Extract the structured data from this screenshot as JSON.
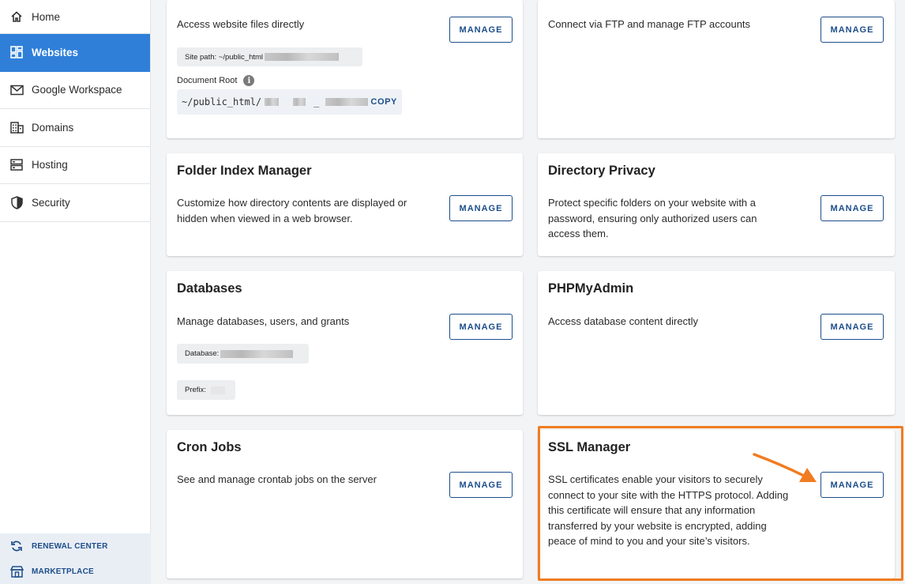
{
  "sidebar": {
    "items": [
      {
        "label": "Home",
        "icon": "home-icon"
      },
      {
        "label": "Websites",
        "icon": "websites-grid-icon"
      },
      {
        "label": "Google Workspace",
        "icon": "mail-icon"
      },
      {
        "label": "Domains",
        "icon": "domains-building-icon"
      },
      {
        "label": "Hosting",
        "icon": "server-icon"
      },
      {
        "label": "Security",
        "icon": "shield-icon"
      }
    ],
    "bottom": [
      {
        "label": "RENEWAL CENTER",
        "icon": "refresh-icon"
      },
      {
        "label": "MARKETPLACE",
        "icon": "store-icon"
      }
    ]
  },
  "colors": {
    "accent": "#2f7fd9",
    "brand_text": "#1d4e8a",
    "highlight": "#f07c22"
  },
  "cards": {
    "file_manager": {
      "desc": "Access website files directly",
      "site_path_label": "Site path: ~/public_html",
      "doc_root_label": "Document Root",
      "doc_root_value": "~/public_html/",
      "doc_root_sep": "_",
      "copy_label": "COPY",
      "manage": "MANAGE"
    },
    "ftp": {
      "desc": "Connect via FTP and manage FTP accounts",
      "manage": "MANAGE"
    },
    "folder_index": {
      "title": "Folder Index Manager",
      "desc": "Customize how directory contents are displayed or hidden when viewed in a web browser.",
      "manage": "MANAGE"
    },
    "directory_privacy": {
      "title": "Directory Privacy",
      "desc": "Protect specific folders on your website with a password, ensuring only authorized users can access them.",
      "manage": "MANAGE"
    },
    "databases": {
      "title": "Databases",
      "desc": "Manage databases, users, and grants",
      "database_label": "Database:",
      "prefix_label": "Prefix:",
      "manage": "MANAGE"
    },
    "phpmyadmin": {
      "title": "PHPMyAdmin",
      "desc": "Access database content directly",
      "manage": "MANAGE"
    },
    "cron_jobs": {
      "title": "Cron Jobs",
      "desc": "See and manage crontab jobs on the server",
      "manage": "MANAGE"
    },
    "ssl_manager": {
      "title": "SSL Manager",
      "desc": "SSL certificates enable your visitors to securely connect to your site with the HTTPS protocol. Adding this certificate will ensure that any information transferred by your website is encrypted, adding peace of mind to you and your site’s visitors.",
      "manage": "MANAGE"
    }
  }
}
